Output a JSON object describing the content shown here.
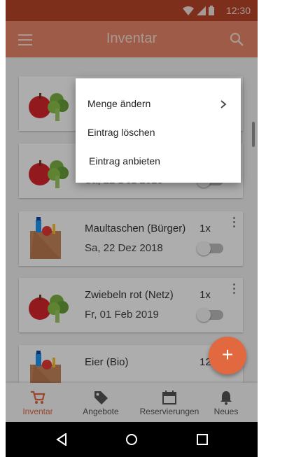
{
  "statusbar": {
    "time": "12:30"
  },
  "appbar": {
    "title": "Inventar"
  },
  "items": [
    {
      "name": "",
      "qty": "",
      "date": "",
      "image": "vegetables-icon"
    },
    {
      "name": "",
      "qty": "",
      "date": "Sa, 22 Dez 2018",
      "image": "vegetables-icon"
    },
    {
      "name": "Maultaschen (Bürger)",
      "qty": "1x",
      "date": "Sa, 22 Dez 2018",
      "image": "grocery-bag-icon"
    },
    {
      "name": "Zwiebeln rot (Netz)",
      "qty": "1x",
      "date": "Fr, 01 Feb 2019",
      "image": "vegetables-icon"
    },
    {
      "name": "Eier (Bio)",
      "qty": "12",
      "date": "",
      "image": "grocery-bag-icon"
    }
  ],
  "fab": {
    "label": "+"
  },
  "bottom_nav": [
    {
      "label": "Inventar",
      "icon": "cart-icon",
      "active": true
    },
    {
      "label": "Angebote",
      "icon": "tag-icon",
      "active": false
    },
    {
      "label": "Reservierungen",
      "icon": "calendar-icon",
      "active": false
    },
    {
      "label": "Neues",
      "icon": "bell-icon",
      "active": false
    }
  ],
  "context_menu": [
    {
      "label": "Menge ändern",
      "has_submenu": true
    },
    {
      "label": "Eintrag löschen",
      "has_submenu": false
    },
    {
      "label": "Eintrag anbieten",
      "has_submenu": false
    }
  ],
  "colors": {
    "primary": "#e8876a",
    "accent": "#e2683f"
  }
}
